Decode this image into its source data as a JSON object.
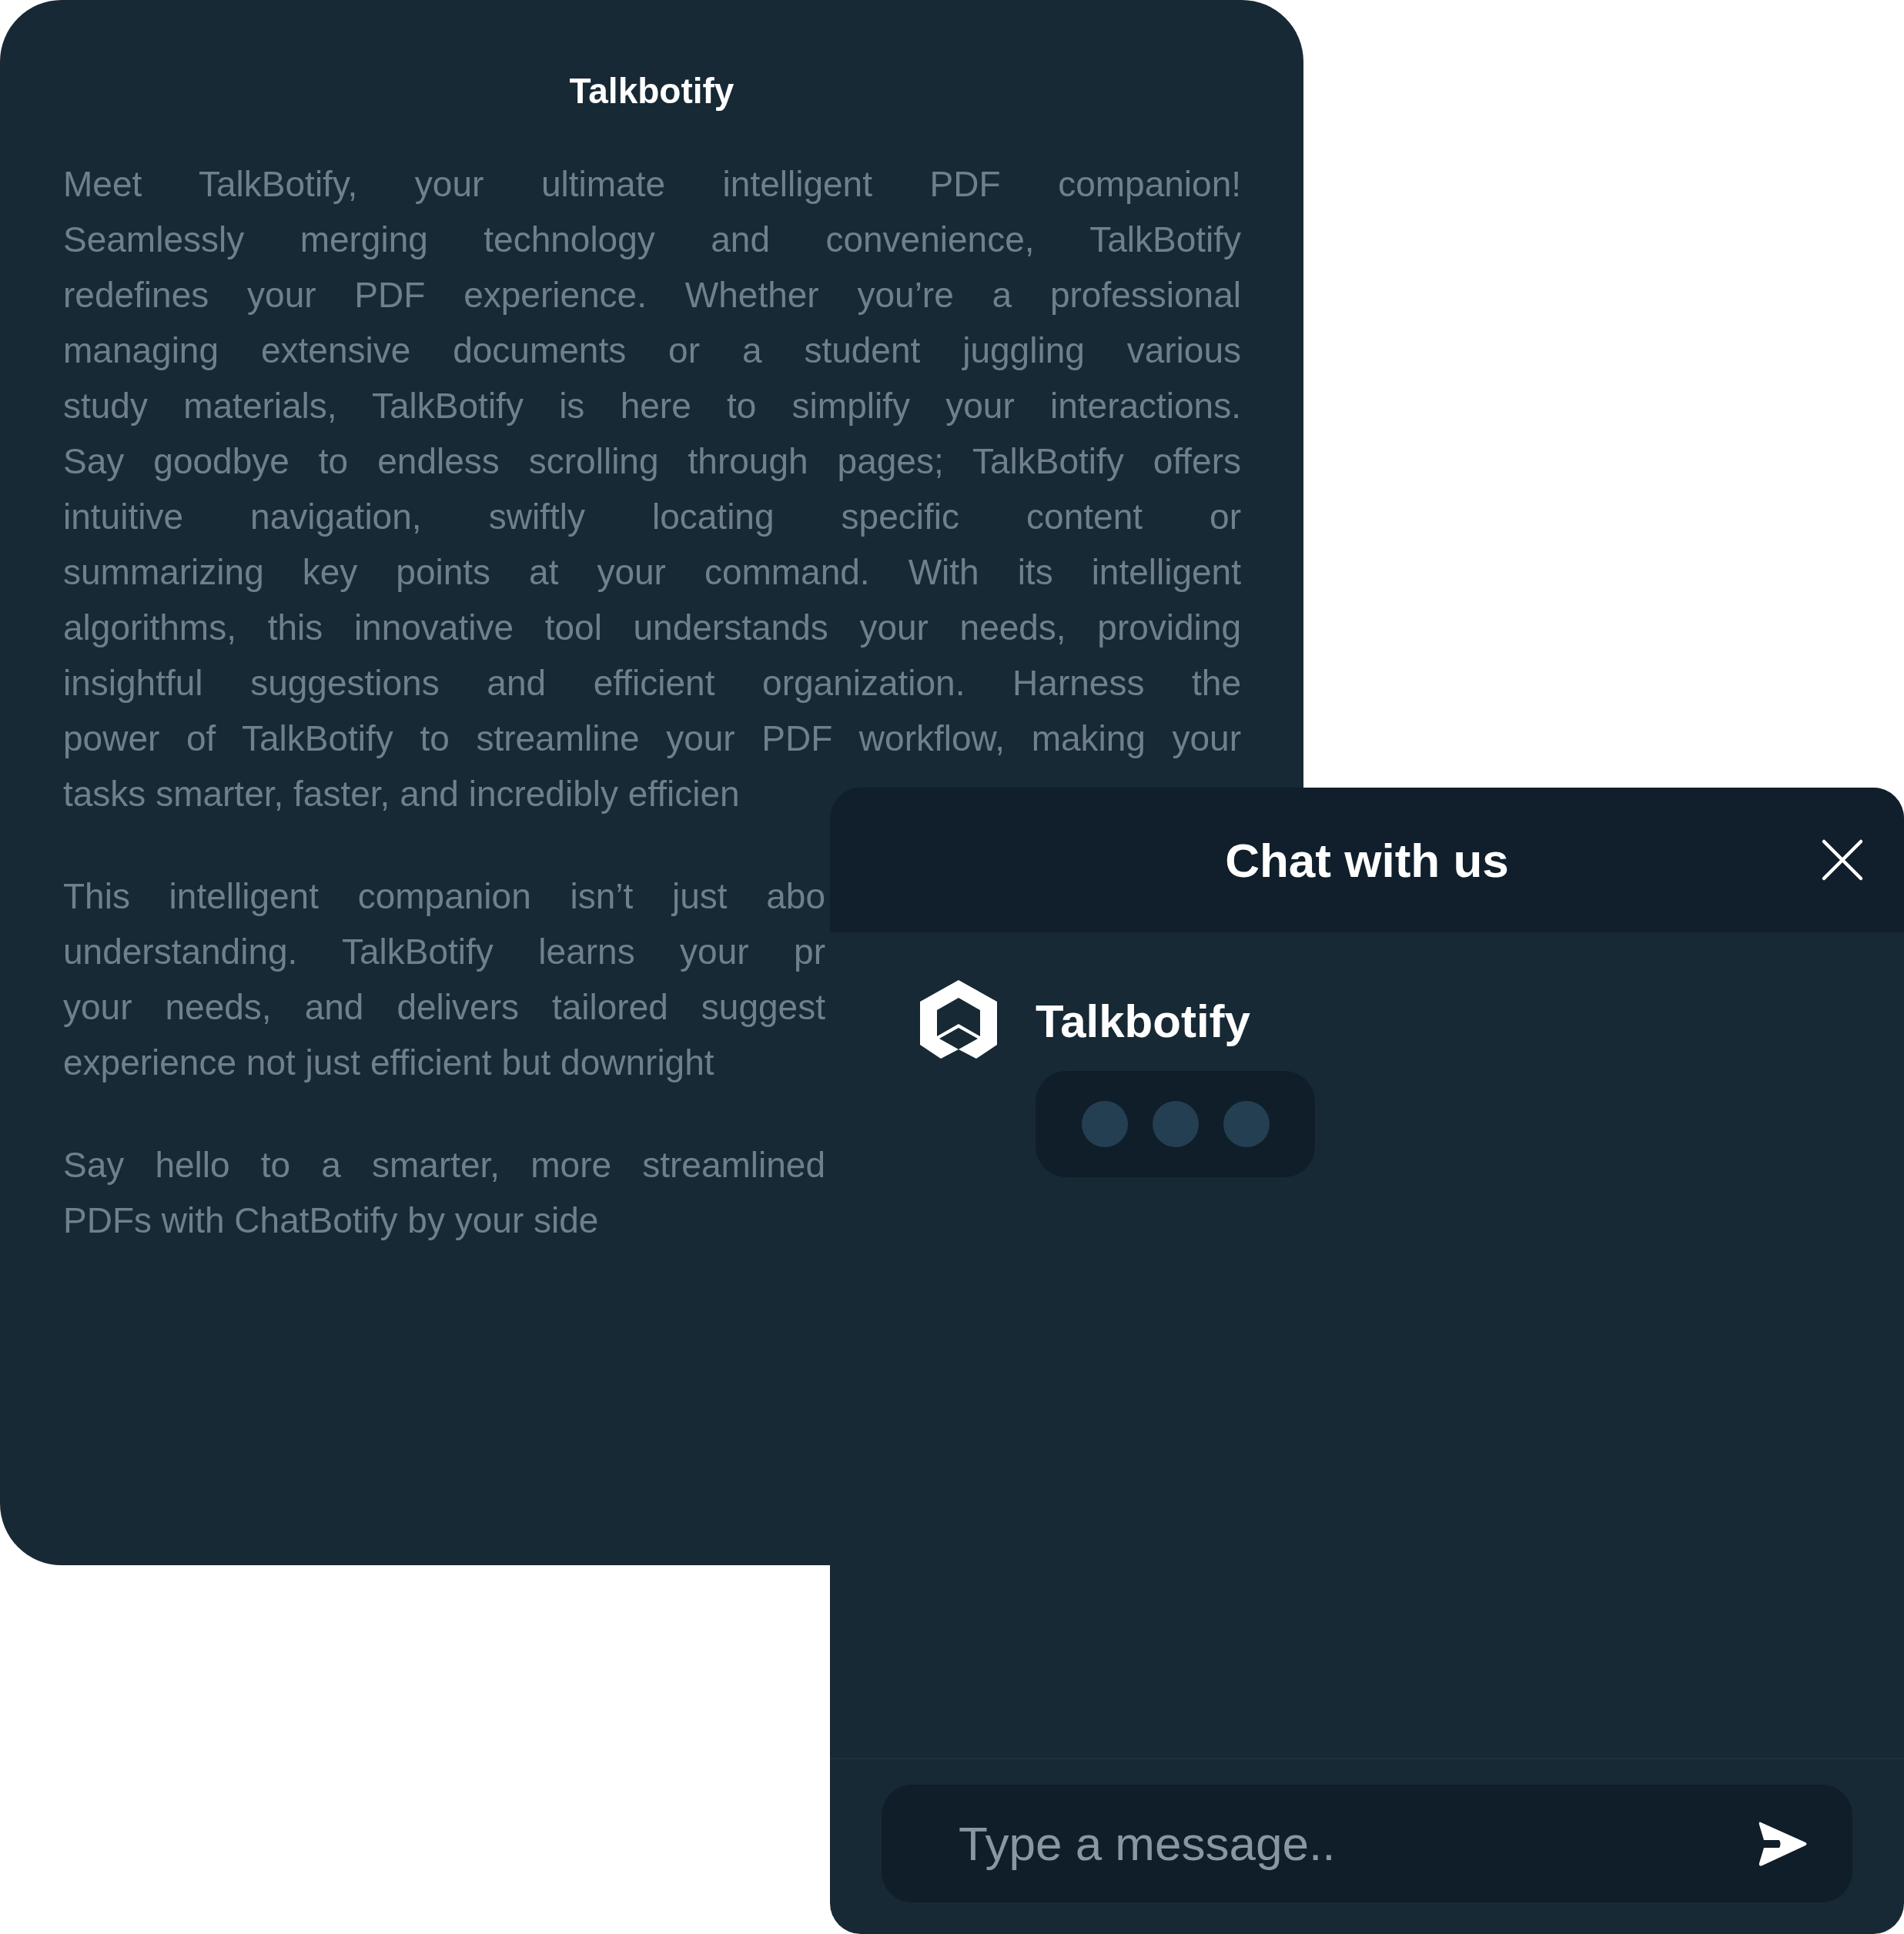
{
  "document": {
    "title": "Talkbotify",
    "paragraphs": [
      {
        "lines": [
          "Meet TalkBotify, your ultimate intelligent PDF companion!",
          "Seamlessly merging technology and convenience, TalkBotify",
          "redefines your PDF experience. Whether you’re a professional",
          "managing extensive documents or a student juggling various",
          "study materials, TalkBotify is here to simplify your interactions.",
          "Say goodbye to endless scrolling through pages; TalkBotify offers",
          "intuitive navigation, swiftly locating specific content or",
          "summarizing key points at your command. With its intelligent",
          "algorithms, this innovative tool understands your needs, providing",
          "insightful suggestions and efficient organization. Harness the",
          "power of TalkBotify to streamline your PDF workflow, making your",
          "tasks smarter, faster, and incredibly efficien"
        ]
      },
      {
        "lines": [
          "This intelligent companion isn’t just abo",
          "understanding. TalkBotify learns your pr",
          "your needs, and delivers tailored suggest",
          "experience not just efficient but downright"
        ]
      },
      {
        "lines": [
          "Say hello to a smarter, more streamlined",
          "PDFs with ChatBotify by your side"
        ]
      }
    ]
  },
  "chat": {
    "title": "Chat with us",
    "bot_name": "Talkbotify",
    "input": {
      "placeholder": "Type a message.."
    }
  }
}
